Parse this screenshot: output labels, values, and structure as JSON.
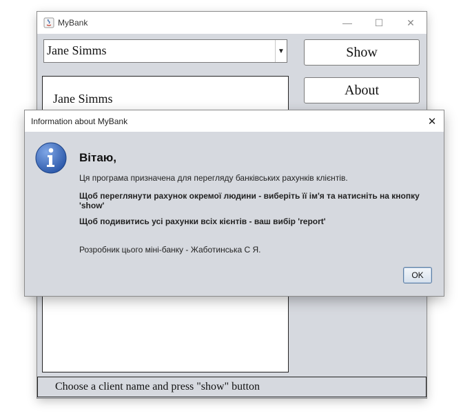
{
  "main_window": {
    "title": "MyBank",
    "controls": {
      "minimize": "—",
      "maximize": "☐",
      "close": "✕"
    },
    "client_select": {
      "value": "Jane Simms",
      "arrow": "▼"
    },
    "buttons": {
      "show": "Show",
      "about": "About"
    },
    "client_list": {
      "items": [
        "Jane Simms"
      ]
    },
    "status": "Choose a client name and press \"show\" button"
  },
  "dialog": {
    "title": "Information about MyBank",
    "close": "✕",
    "icon": "info-icon",
    "heading": "Вітаю,",
    "lines": [
      "Ця програма призначена для перегляду банківських рахунків клієнтів.",
      "Щоб переглянути рахунок окремої людини - виберіть її ім'я та натисніть на кнопку 'show'",
      "Щоб подивитись усі рахунки всіх кієнтів - ваш вибір 'report'",
      "Розробник цього міні-банку - Жаботинська С Я."
    ],
    "ok": "OK"
  },
  "colors": {
    "accent": "#5b7da3",
    "window_bg": "#d6d9df",
    "info_icon": "#3a68b8"
  }
}
